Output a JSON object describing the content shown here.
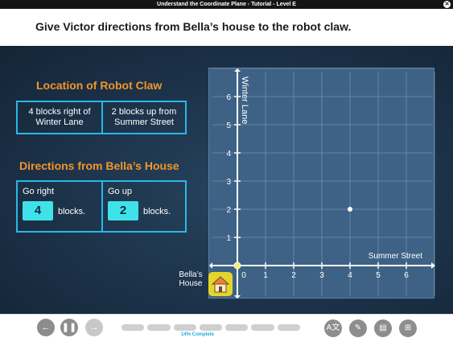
{
  "window": {
    "title": "Understand the Coordinate Plane - Tutorial - Level E",
    "close_icon": "close-icon"
  },
  "prompt": "Give Victor directions from Bella’s house to the robot claw.",
  "location": {
    "heading": "Location of Robot Claw",
    "cells": [
      "4 blocks right of Winter Lane",
      "2 blocks up from Summer Street"
    ]
  },
  "directions": {
    "heading": "Directions from Bella’s House",
    "right_label": "Go right",
    "right_value": "4",
    "up_label": "Go up",
    "up_value": "2",
    "unit": "blocks."
  },
  "grid": {
    "x_axis_label": "Summer Street",
    "y_axis_label": "Winter Lane",
    "x_ticks": [
      "0",
      "1",
      "2",
      "3",
      "4",
      "5",
      "6"
    ],
    "y_ticks": [
      "1",
      "2",
      "3",
      "4",
      "5",
      "6"
    ],
    "house_label": "Bella’s House",
    "point": {
      "x": 4,
      "y": 2
    }
  },
  "footer": {
    "progress_percent": 14,
    "progress_label": "14% Complete",
    "colors": {
      "accent": "#2aa9e0",
      "highlight": "#3fe2e8",
      "heading": "#f2952b"
    }
  }
}
